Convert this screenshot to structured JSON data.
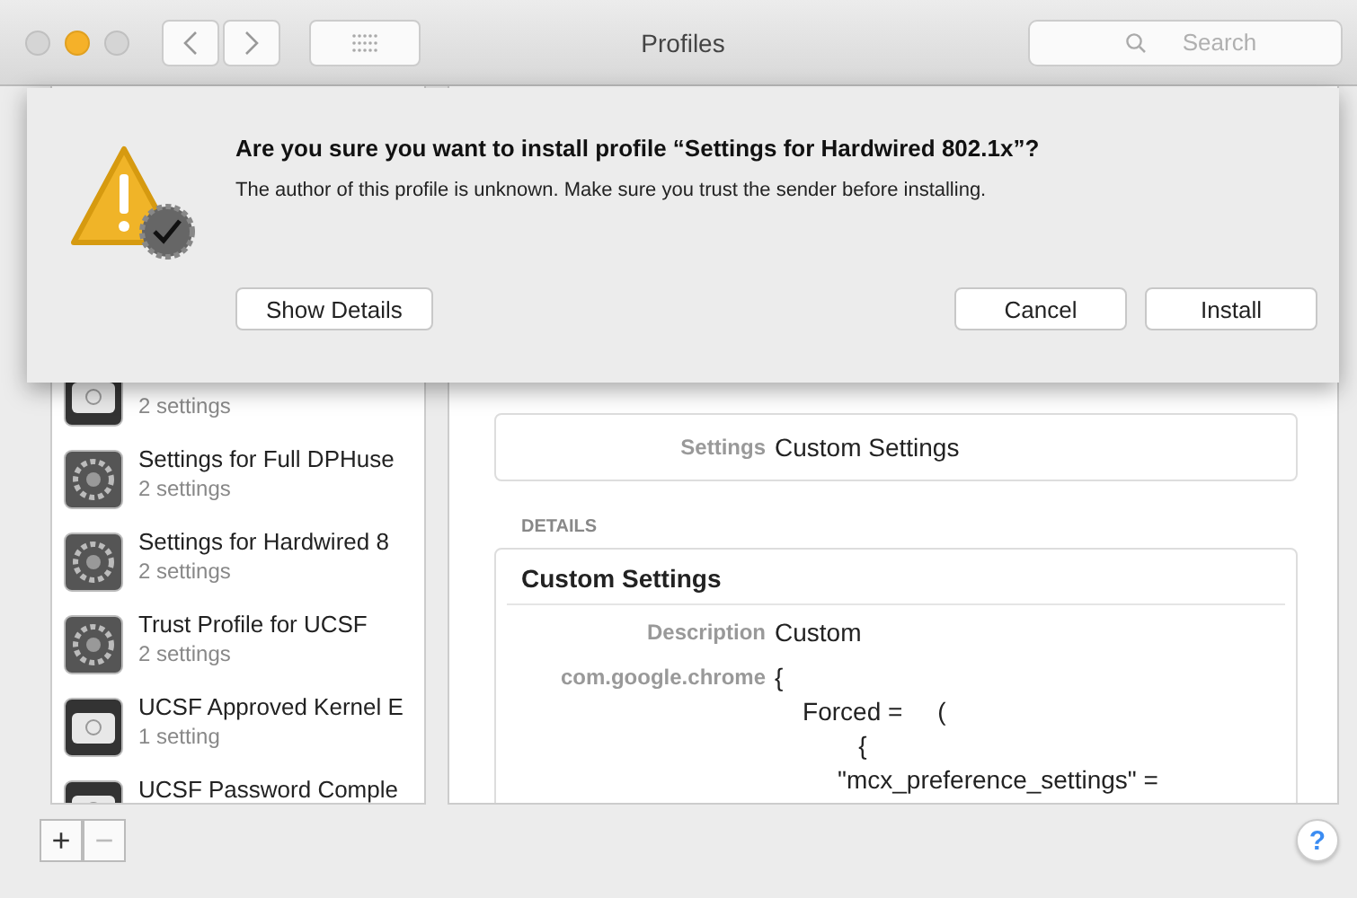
{
  "window": {
    "title": "Profiles"
  },
  "toolbar": {
    "search": {
      "placeholder": "Search"
    }
  },
  "sidebar": {
    "items": [
      {
        "subtitle": "2 settings",
        "kind": "profile",
        "selected": false
      },
      {
        "name": "Settings for Full DPHuse",
        "subtitle": "2 settings",
        "kind": "gear",
        "selected": false
      },
      {
        "name": "Settings for Hardwired 8",
        "subtitle": "2 settings",
        "kind": "gear",
        "selected": false
      },
      {
        "name": "Trust Profile for UCSF",
        "subtitle": "2 settings",
        "kind": "gear",
        "selected": false
      },
      {
        "name": "UCSF Approved Kernel E",
        "subtitle": "1 setting",
        "kind": "profile",
        "selected": false
      },
      {
        "name": "UCSF Password Comple",
        "kind": "profile",
        "selected": false
      }
    ],
    "add_button": "+",
    "remove_button": "−"
  },
  "detail": {
    "settings_label": "Settings",
    "settings_value": "Custom Settings",
    "details_heading": "DETAILS",
    "card_title": "Custom Settings",
    "rows": [
      {
        "label": "Description",
        "lines": [
          "Custom"
        ]
      },
      {
        "label": "com.google.chrome",
        "lines": [
          "{",
          "    Forced =     (",
          "            {",
          "         \"mcx_preference_settings\" ="
        ]
      }
    ]
  },
  "help_button": "?",
  "sheet": {
    "title": "Are you sure you want to install profile “Settings for Hardwired 802.1x”?",
    "message": "The author of this profile is unknown. Make sure you trust the sender before installing.",
    "buttons": [
      {
        "label": "Show Details",
        "kind": "left"
      },
      {
        "label": "Cancel",
        "kind": "right"
      },
      {
        "label": "Install",
        "kind": "right"
      }
    ]
  }
}
